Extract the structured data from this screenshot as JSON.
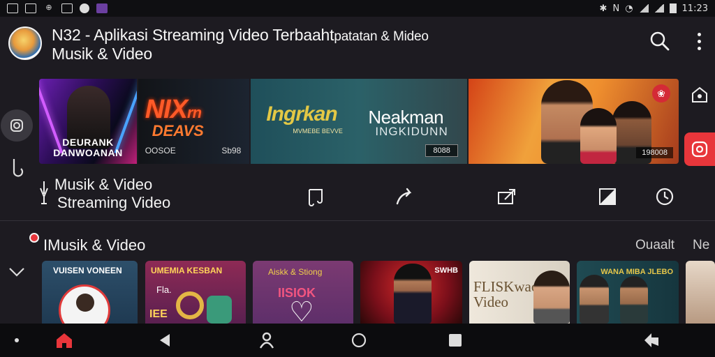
{
  "status_bar": {
    "left_icons": [
      "photo-icon",
      "image-icon",
      "signal-icon",
      "gallery-icon",
      "record-icon",
      "app-icon"
    ],
    "time": "11:23",
    "right_icons": [
      "bluetooth-icon",
      "nfc-icon",
      "wifi-icon",
      "cell-signal-icon",
      "cell-signal-icon",
      "battery-icon"
    ]
  },
  "header": {
    "title": "N32 - Aplikasi Streaming Video Terbaahtpatatan & Mideo Musik & Video",
    "title_line1": "N32 - Aplikasi Streaming Video Terbaaht",
    "title_line1_suffix": "patatan & Mideo",
    "title_line2": "Musik & Video"
  },
  "banner": {
    "cards": [
      {
        "caption_line1": "DEURANK",
        "caption_line2": "DANWOANAN"
      },
      {
        "title": "NIX",
        "title_suffix": "rn",
        "subtitle": "DEAVS",
        "left_label": "OOSOE",
        "right_label": "Sb98"
      },
      {
        "logo": "Ingrkan",
        "logo_sub": "MVMEBE BEVVE",
        "name": "Neakman",
        "name_sub": "INGKIDUNN",
        "badge": "8088"
      },
      {
        "badge": "198008"
      }
    ]
  },
  "section1": {
    "line1": "Musik & Video",
    "line2": "Streaming Video"
  },
  "section2": {
    "title": "IMusik & Video",
    "tabs": [
      "Ouaalt",
      "Ne"
    ]
  },
  "tiles": [
    {
      "title": "VUISEN VONEEN"
    },
    {
      "title": "UMEMIA KESBAN",
      "subtitle": "Fla.",
      "number": "IEE"
    },
    {
      "title": "Aiskk & Stiong",
      "subtitle": "IISIOK"
    },
    {
      "title": "SWHB"
    },
    {
      "title": "FLISKwaoma Video"
    },
    {
      "title": "WANA MIBA JLEBO"
    },
    {
      "title": ""
    }
  ],
  "colors": {
    "background": "#1d1b21",
    "accent": "#e8363b",
    "nav_home": "#e8363b"
  }
}
